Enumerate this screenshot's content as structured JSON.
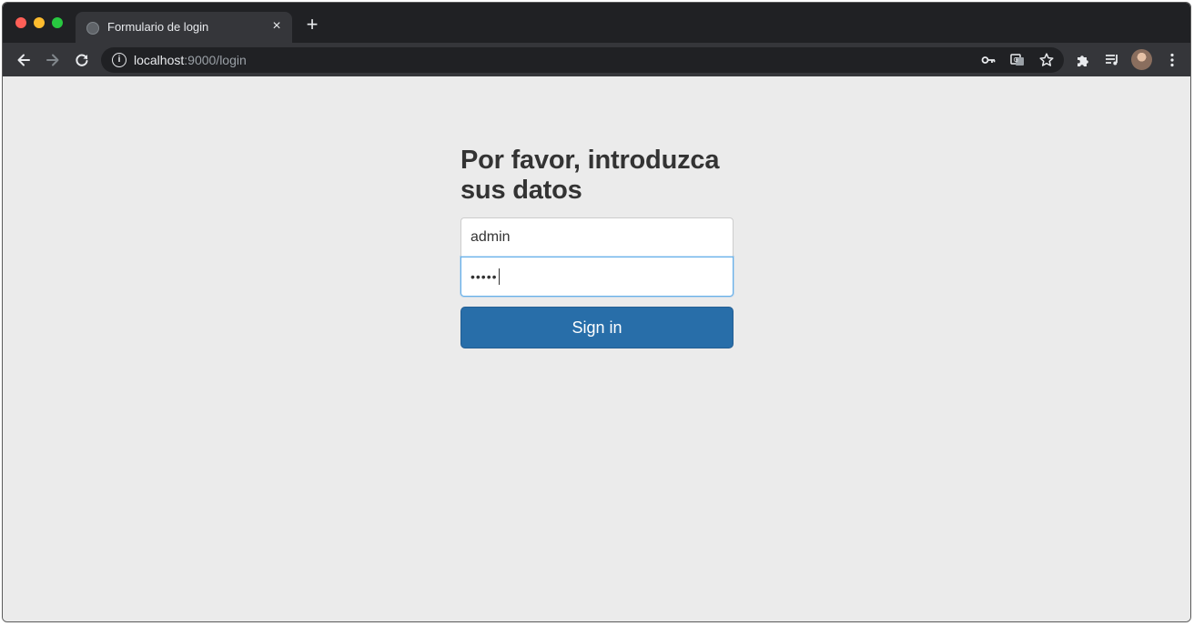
{
  "browser": {
    "tab": {
      "title": "Formulario de login",
      "favicon": "globe-icon",
      "close": "×"
    },
    "new_tab": "+",
    "address": {
      "host": "localhost",
      "path": ":9000/login"
    },
    "icons": [
      "back-icon",
      "forward-icon",
      "reload-icon",
      "info-icon",
      "key-icon",
      "translate-icon",
      "star-icon",
      "extensions-icon",
      "media-queue-icon",
      "avatar",
      "menu-icon"
    ]
  },
  "login": {
    "heading": "Por favor, introduzca sus datos",
    "username_value": "admin",
    "password_mask": "•••••",
    "submit_label": "Sign in"
  },
  "colors": {
    "page_bg": "#ebebeb",
    "primary_button": "#286ea9",
    "focus_border": "#66afe9",
    "heading_text": "#333333"
  }
}
